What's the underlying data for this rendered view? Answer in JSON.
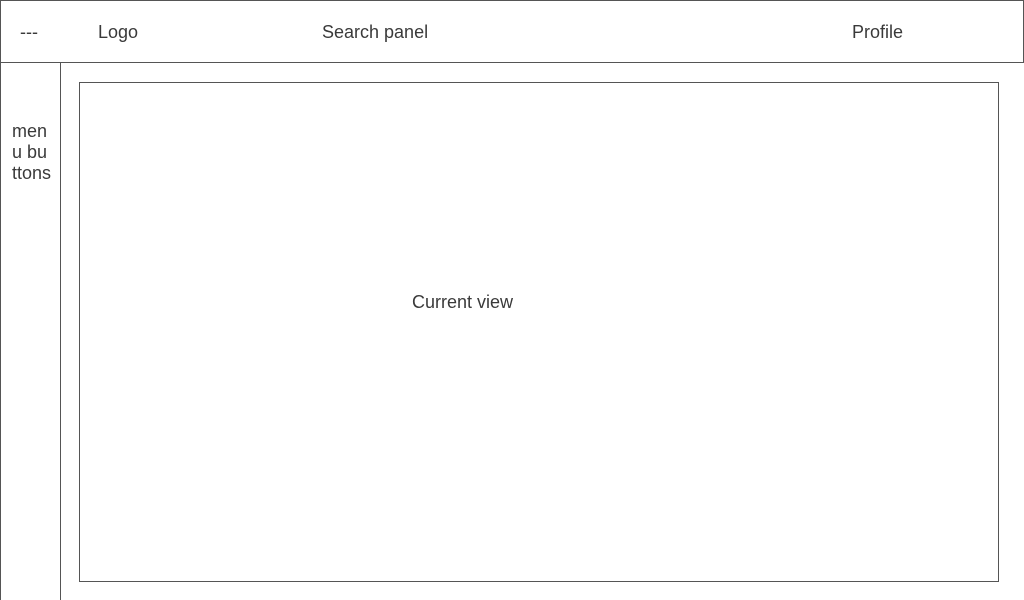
{
  "header": {
    "menu_toggle": "---",
    "logo": "Logo",
    "search": "Search panel",
    "profile": "Profile"
  },
  "sidebar": {
    "label": "menu buttons"
  },
  "main": {
    "label": "Current view"
  }
}
